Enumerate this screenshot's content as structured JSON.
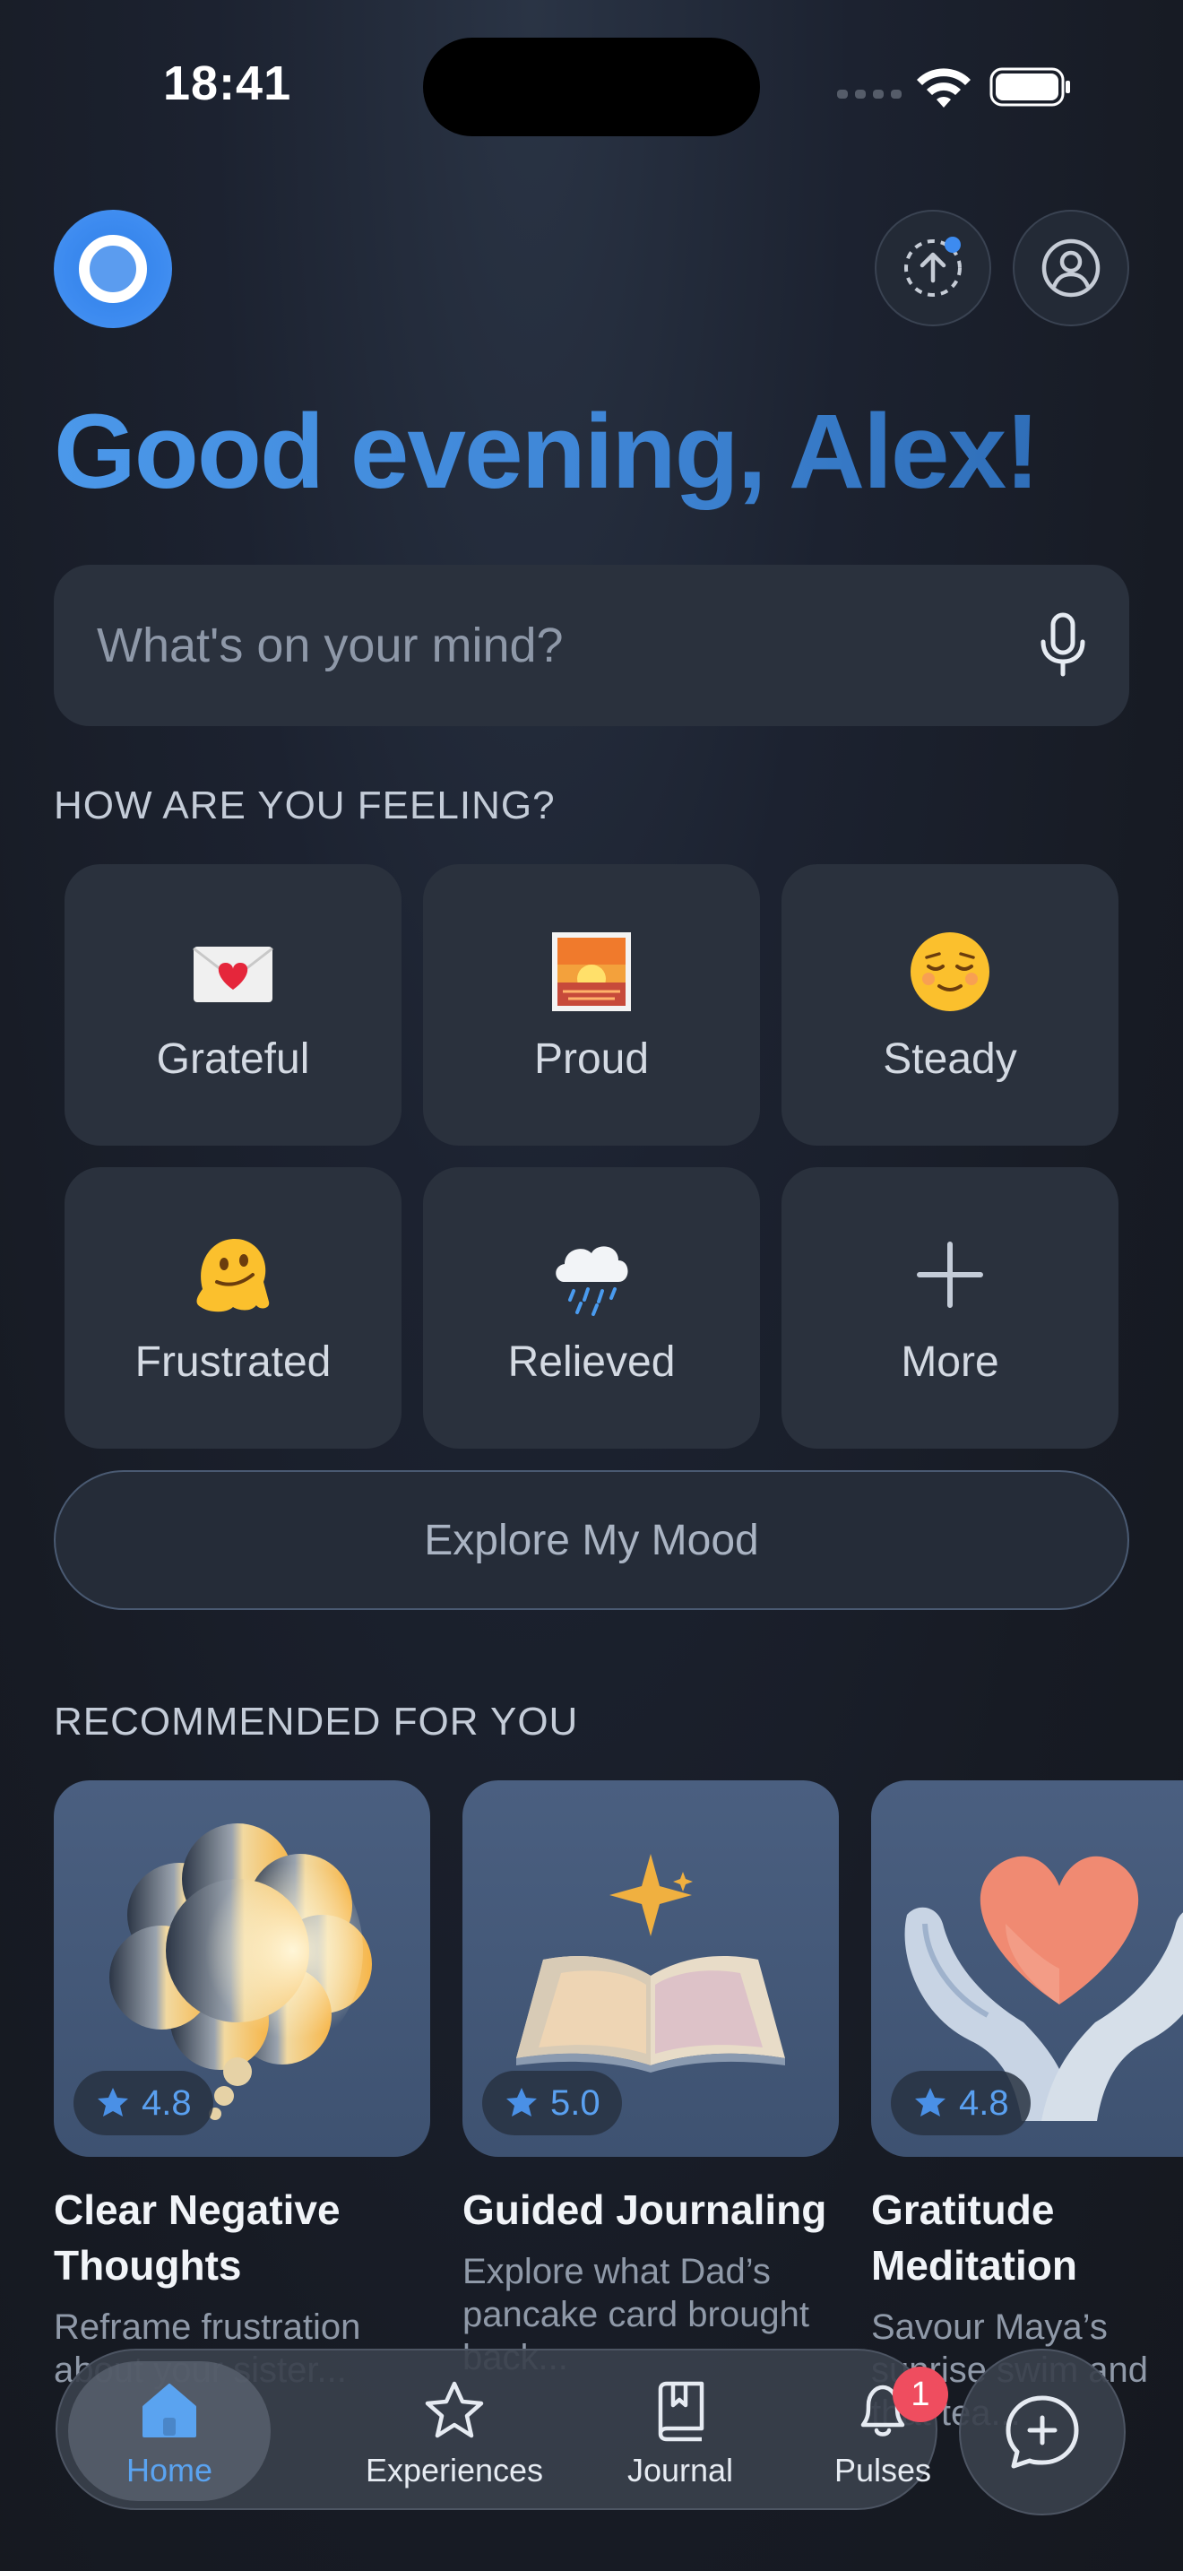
{
  "status_bar": {
    "time": "18:41"
  },
  "header": {
    "logo_icon": "app-logo-ring-icon",
    "upload_icon": "upload-circle-icon",
    "profile_icon": "user-circle-icon"
  },
  "greeting": "Good evening, Alex!",
  "search": {
    "placeholder": "What's on your mind?",
    "mic_icon": "microphone-icon"
  },
  "mood_section": {
    "label": "HOW ARE YOU FEELING?",
    "moods": [
      {
        "label": "Grateful",
        "icon": "love-letter-emoji"
      },
      {
        "label": "Proud",
        "icon": "sunrise-emoji"
      },
      {
        "label": "Steady",
        "icon": "relieved-face-emoji"
      },
      {
        "label": "Frustrated",
        "icon": "melting-face-emoji"
      },
      {
        "label": "Relieved",
        "icon": "rain-cloud-emoji"
      },
      {
        "label": "More",
        "icon": "plus-icon"
      }
    ],
    "explore_button": "Explore My Mood"
  },
  "recommended": {
    "label": "RECOMMENDED FOR YOU",
    "items": [
      {
        "rating": "4.8",
        "title": "Clear Negative Thoughts",
        "description": "Reframe frustration about your sister..."
      },
      {
        "rating": "5.0",
        "title": "Guided Journaling",
        "description": "Explore what Dad’s pancake card brought back..."
      },
      {
        "rating": "4.8",
        "title": "Gratitude Meditation",
        "description": "Savour Maya’s sunrise swim and that tea..."
      }
    ]
  },
  "tabbar": {
    "tabs": [
      {
        "label": "Home",
        "icon": "home-icon",
        "active": true
      },
      {
        "label": "Experiences",
        "icon": "star-icon"
      },
      {
        "label": "Journal",
        "icon": "journal-book-icon"
      },
      {
        "label": "Pulses",
        "icon": "bell-icon",
        "badge": "1"
      }
    ],
    "chat_icon": "chat-plus-icon"
  },
  "colors": {
    "accent": "#3d8bf0",
    "badge": "#ef4d5f",
    "tile": "#2a313d",
    "background": "#171b24"
  }
}
